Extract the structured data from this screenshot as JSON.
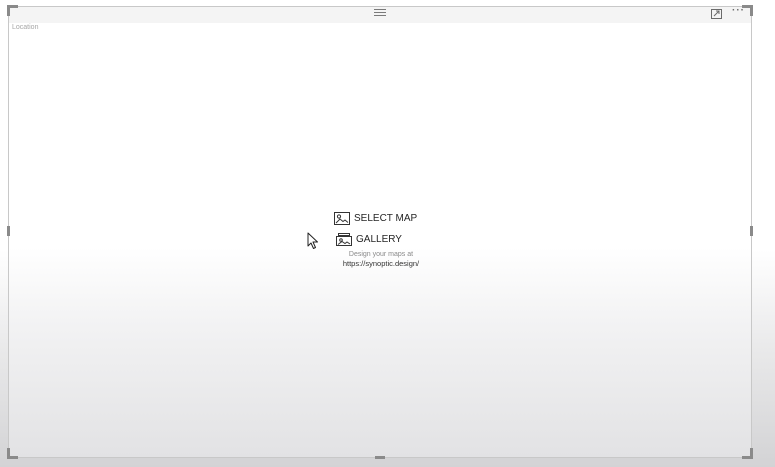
{
  "visual": {
    "title": "Location",
    "header_icons": {
      "focus": "focus-mode-icon",
      "more": "more-options-icon",
      "more_glyph": "···"
    }
  },
  "actions": {
    "select_map": {
      "label": "SELECT MAP",
      "icon": "map-image-icon"
    },
    "gallery": {
      "label": "GALLERY",
      "icon": "gallery-icon"
    }
  },
  "info": {
    "caption": "Design your maps at",
    "link": "https://synoptic.design/"
  },
  "colors": {
    "border": "#c8c8c8",
    "text": "#252525",
    "muted": "#8a8a8a"
  }
}
